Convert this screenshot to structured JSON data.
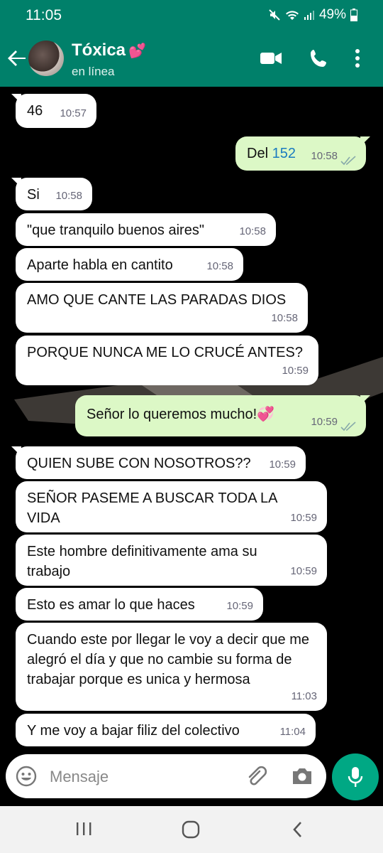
{
  "status_bar": {
    "time": "11:05",
    "battery": "49%"
  },
  "header": {
    "contact_name": "Tóxica",
    "heart": "💕",
    "status": "en línea"
  },
  "messages": [
    {
      "dir": "in",
      "text": "46",
      "time": "10:57"
    },
    {
      "dir": "out",
      "text": "Del ",
      "link": "152",
      "time": "10:58"
    },
    {
      "dir": "in",
      "text": "Si",
      "time": "10:58"
    },
    {
      "dir": "in",
      "text": "\"que tranquilo buenos aires\"",
      "time": "10:58"
    },
    {
      "dir": "in",
      "text": "Aparte habla en cantito",
      "time": "10:58"
    },
    {
      "dir": "in",
      "text": "AMO QUE CANTE LAS PARADAS DIOS",
      "time": "10:58"
    },
    {
      "dir": "in",
      "text": "PORQUE NUNCA ME LO CRUCÉ ANTES?",
      "time": "10:59"
    },
    {
      "dir": "out",
      "text": "Señor lo queremos mucho!",
      "emoji": "💞",
      "time": "10:59"
    },
    {
      "dir": "in",
      "text": "QUIEN SUBE CON NOSOTROS??",
      "time": "10:59"
    },
    {
      "dir": "in",
      "text": "SEÑOR PASEME A BUSCAR TODA LA VIDA",
      "time": "10:59"
    },
    {
      "dir": "in",
      "text": "Este hombre definitivamente ama su trabajo",
      "time": "10:59"
    },
    {
      "dir": "in",
      "text": "Esto es amar lo que haces",
      "time": "10:59"
    },
    {
      "dir": "in",
      "text": "Cuando este por llegar le voy a decir que me alegró el día y que no cambie su forma de trabajar porque es unica y hermosa",
      "time": "11:03"
    },
    {
      "dir": "in",
      "text": "Y me voy a bajar filiz del colectivo",
      "time": "11:04"
    }
  ],
  "composer": {
    "placeholder": "Mensaje"
  },
  "icons": {
    "back": "arrow-left-icon",
    "video": "video-call-icon",
    "phone": "phone-icon",
    "menu": "more-vert-icon",
    "emoji": "emoji-icon",
    "attach": "paperclip-icon",
    "camera": "camera-icon",
    "mic": "microphone-icon"
  },
  "colors": {
    "header": "#00806a",
    "outgoing": "#dcf8c6",
    "incoming": "#ffffff",
    "mic": "#00a884",
    "link": "#1a7bc0"
  }
}
